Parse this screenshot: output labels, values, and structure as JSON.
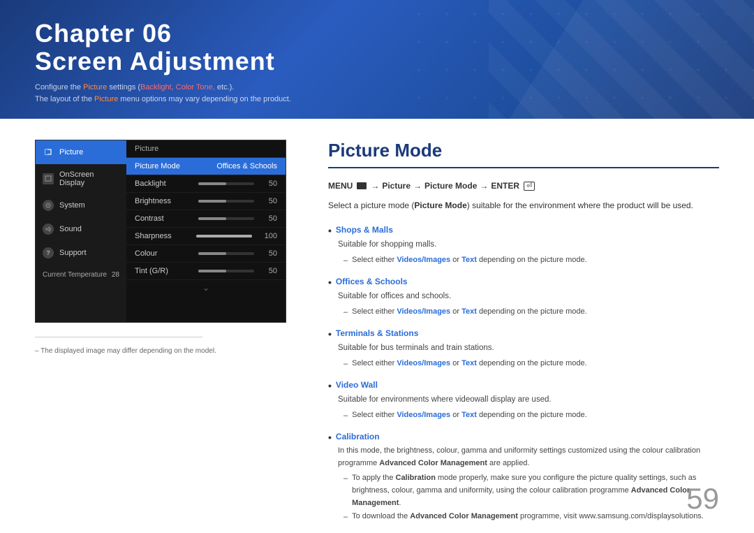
{
  "header": {
    "chapter": "Chapter  06",
    "title": "Screen Adjustment",
    "desc1_prefix": "Configure the ",
    "desc1_highlight1": "Picture",
    "desc1_middle": " settings (",
    "desc1_highlight2": "Backlight, Color Tone,",
    "desc1_suffix": " etc.).",
    "desc2_prefix": "The layout of the ",
    "desc2_highlight": "Picture",
    "desc2_suffix": " menu options may vary depending on the product."
  },
  "mockup": {
    "header": "Picture",
    "sidebar": {
      "items": [
        {
          "label": "Picture",
          "active": true
        },
        {
          "label": "OnScreen Display",
          "active": false
        },
        {
          "label": "System",
          "active": false
        },
        {
          "label": "Sound",
          "active": false
        },
        {
          "label": "Support",
          "active": false
        }
      ],
      "temp_label": "Current Temperature",
      "temp_value": "28"
    },
    "main_header": "Picture",
    "rows": [
      {
        "label": "Picture Mode",
        "value": "Offices & Schools",
        "highlight": true,
        "bar": false
      },
      {
        "label": "Backlight",
        "value": "50",
        "bar": true,
        "fill": 50
      },
      {
        "label": "Brightness",
        "value": "50",
        "bar": true,
        "fill": 50
      },
      {
        "label": "Contrast",
        "value": "50",
        "bar": true,
        "fill": 50
      },
      {
        "label": "Sharpness",
        "value": "100",
        "bar": true,
        "fill": 100
      },
      {
        "label": "Colour",
        "value": "50",
        "bar": true,
        "fill": 50
      },
      {
        "label": "Tint (G/R)",
        "value": "50",
        "bar": true,
        "fill": 50
      }
    ]
  },
  "note": "–  The displayed image may differ depending on the model.",
  "section": {
    "title": "Picture Mode",
    "menu_path": "MENU  → Picture → Picture Mode → ENTER ",
    "intro": "Select a picture mode (Picture Mode) suitable for the environment where the product will be used.",
    "bullets": [
      {
        "title": "Shops & Malls",
        "desc": "Suitable for shopping malls.",
        "sub": "Select either Videos/Images or Text depending on the picture mode."
      },
      {
        "title": "Offices & Schools",
        "desc": "Suitable for offices and schools.",
        "sub": "Select either Videos/Images or Text depending on the picture mode."
      },
      {
        "title": "Terminals & Stations",
        "desc": "Suitable for bus terminals and train stations.",
        "sub": "Select either Videos/Images or Text depending on the picture mode."
      },
      {
        "title": "Video Wall",
        "desc": "Suitable for environments where videowall display are used.",
        "sub": "Select either Videos/Images or Text depending on the picture mode."
      }
    ],
    "calibration": {
      "title": "Calibration",
      "desc1": "In this mode, the brightness, colour, gamma and uniformity settings customized using the colour calibration programme Advanced Color Management are applied.",
      "sub1": "To apply the Calibration mode properly, make sure you configure the picture quality settings, such as brightness, colour, gamma and uniformity, using the colour calibration programme Advanced Color Management.",
      "sub2": "To download the Advanced Color Management programme, visit www.samsung.com/displaysolutions."
    }
  },
  "page_number": "59"
}
